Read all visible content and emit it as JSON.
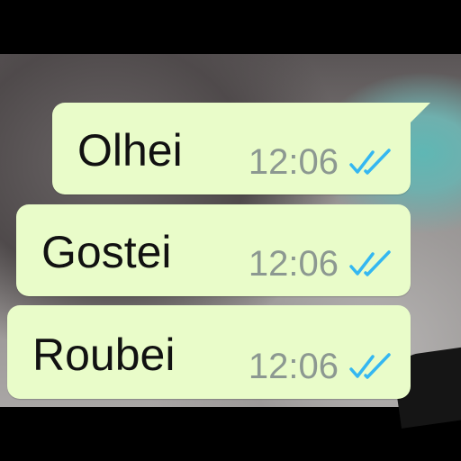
{
  "messages": [
    {
      "text": "Olhei",
      "time": "12:06",
      "status_icon": "double-check-read-icon"
    },
    {
      "text": "Gostei",
      "time": "12:06",
      "status_icon": "double-check-read-icon"
    },
    {
      "text": "Roubei",
      "time": "12:06",
      "status_icon": "double-check-read-icon"
    }
  ],
  "colors": {
    "bubble": "#e9fcc9",
    "text": "#111111",
    "time": "#8c9891",
    "read_ticks": "#34b7f1"
  }
}
